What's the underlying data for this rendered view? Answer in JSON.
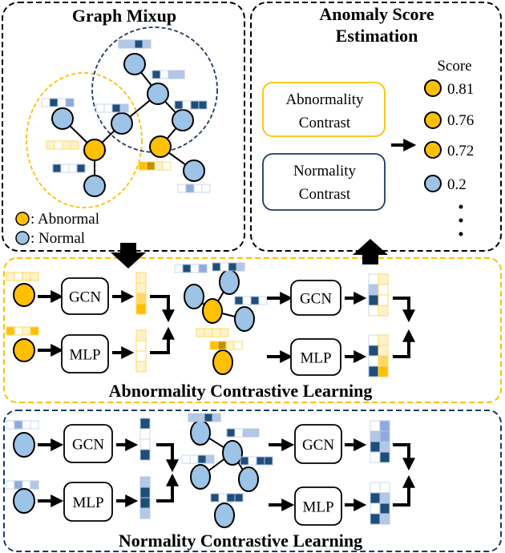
{
  "graph_mixup": {
    "title": "Graph Mixup",
    "legend": {
      "abnormal": ": Abnormal",
      "normal": ": Normal"
    }
  },
  "anomaly_score": {
    "title_line1": "Anomaly Score",
    "title_line2": "Estimation",
    "abnormality_contrast": {
      "line1": "Abnormality",
      "line2": "Contrast"
    },
    "normality_contrast": {
      "line1": "Normality",
      "line2": "Contrast"
    },
    "score_header": "Score",
    "scores": [
      "0.81",
      "0.76",
      "0.72",
      "0.2"
    ]
  },
  "abnormality_learning": {
    "title": "Abnormality Contrastive Learning",
    "gcn": "GCN",
    "mlp": "MLP",
    "gcn2": "GCN",
    "mlp2": "MLP"
  },
  "normality_learning": {
    "title": "Normality Contrastive Learning",
    "gcn": "GCN",
    "mlp": "MLP",
    "gcn2": "GCN",
    "mlp2": "MLP"
  },
  "colors": {
    "abnormal": "#FFC000",
    "normal": "#9DC3E6",
    "abnormal_border": "#FFC000",
    "normal_border": "#1F3864"
  }
}
